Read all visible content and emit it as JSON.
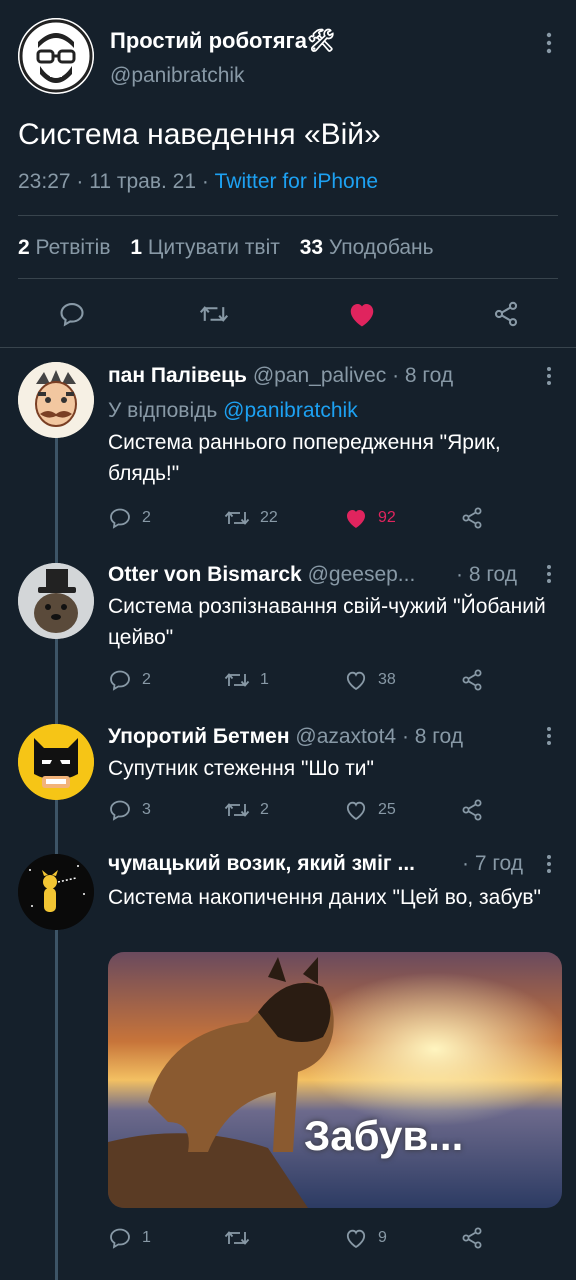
{
  "main": {
    "name": "Простий роботяга🛠",
    "handle": "@panibratchik",
    "text": "Система наведення «Вій»",
    "time": "23:27 · 11 трав. 21 · ",
    "client": "Twitter for iPhone",
    "stats": {
      "retweets_count": "2",
      "retweets_label": "Ретвітів",
      "quotes_count": "1",
      "quotes_label": "Цитувати твіт",
      "likes_count": "33",
      "likes_label": "Уподобань"
    },
    "liked": true
  },
  "replies": [
    {
      "name": "пан Палівець",
      "handle": "@pan_palivec",
      "time": "· 8 год",
      "reply_to_label": "У відповідь ",
      "reply_to_handle": "@panibratchik",
      "text": "Система раннього попередження \"Ярик, блядь!\"",
      "replies": "2",
      "retweets": "22",
      "likes": "92",
      "liked": true
    },
    {
      "name": "Otter von Bismarck",
      "handle": "@geesep...",
      "time": "· 8 год",
      "text": "Система розпізнавання свій-чужий \"Йобаний цейво\"",
      "replies": "2",
      "retweets": "1",
      "likes": "38",
      "liked": false
    },
    {
      "name": "Упоротий Бетмен",
      "handle": "@azaxtot4",
      "time": "· 8 год",
      "text": "Супутник стеження \"Шо ти\"",
      "replies": "3",
      "retweets": "2",
      "likes": "25",
      "liked": false
    },
    {
      "name": "чумацький возик, який зміг ...",
      "handle": "",
      "time": "· 7 год",
      "text": "Система накопичення даних \"Цей во, забув\"",
      "media_caption": "Забув...",
      "replies": "1",
      "retweets": "",
      "likes": "9",
      "liked": false
    }
  ],
  "colors": {
    "background": "#15202b",
    "muted": "#8899a6",
    "link": "#1da1f2",
    "like": "#e0245e"
  },
  "icons": [
    "reply-icon",
    "retweet-icon",
    "like-icon",
    "share-icon",
    "more-icon"
  ]
}
